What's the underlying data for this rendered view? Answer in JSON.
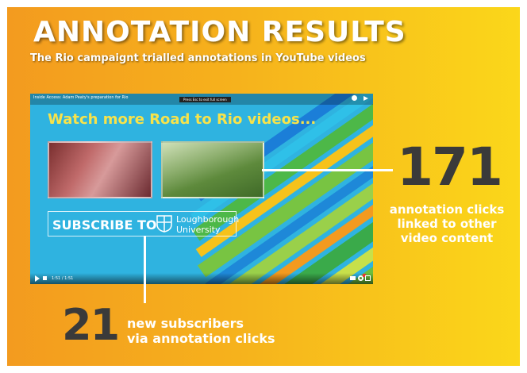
{
  "header": {
    "title": "ANNOTATION RESULTS",
    "subtitle": "The Rio campaignt trialled annotations in YouTube videos"
  },
  "video": {
    "title": "Inside Access: Adam Peaty's preparation for Rio",
    "overlay_message": "Press Esc to exit full screen",
    "endscreen_heading": "Watch more Road to Rio videos...",
    "subscribe_label": "SUBSCRIBE TO",
    "university_name_line1": "Loughborough",
    "university_name_line2": "University",
    "time": "1:51 / 1:51",
    "icons": [
      "info-icon",
      "share-icon",
      "play-icon",
      "volume-icon",
      "captions-icon",
      "settings-icon",
      "fullscreen-icon"
    ]
  },
  "stats": {
    "clicks_number": "171",
    "clicks_label": "annotation clicks linked to other video content",
    "subscribers_number": "21",
    "subscribers_label_line1": "new subscribers",
    "subscribers_label_line2": "via annotation clicks"
  },
  "colors": {
    "background_start": "#f39a1f",
    "background_end": "#fbd81a",
    "stat_number": "#3a3a3a",
    "video_blue": "#2fb3e0",
    "heading_yellow": "#f7e34a"
  }
}
